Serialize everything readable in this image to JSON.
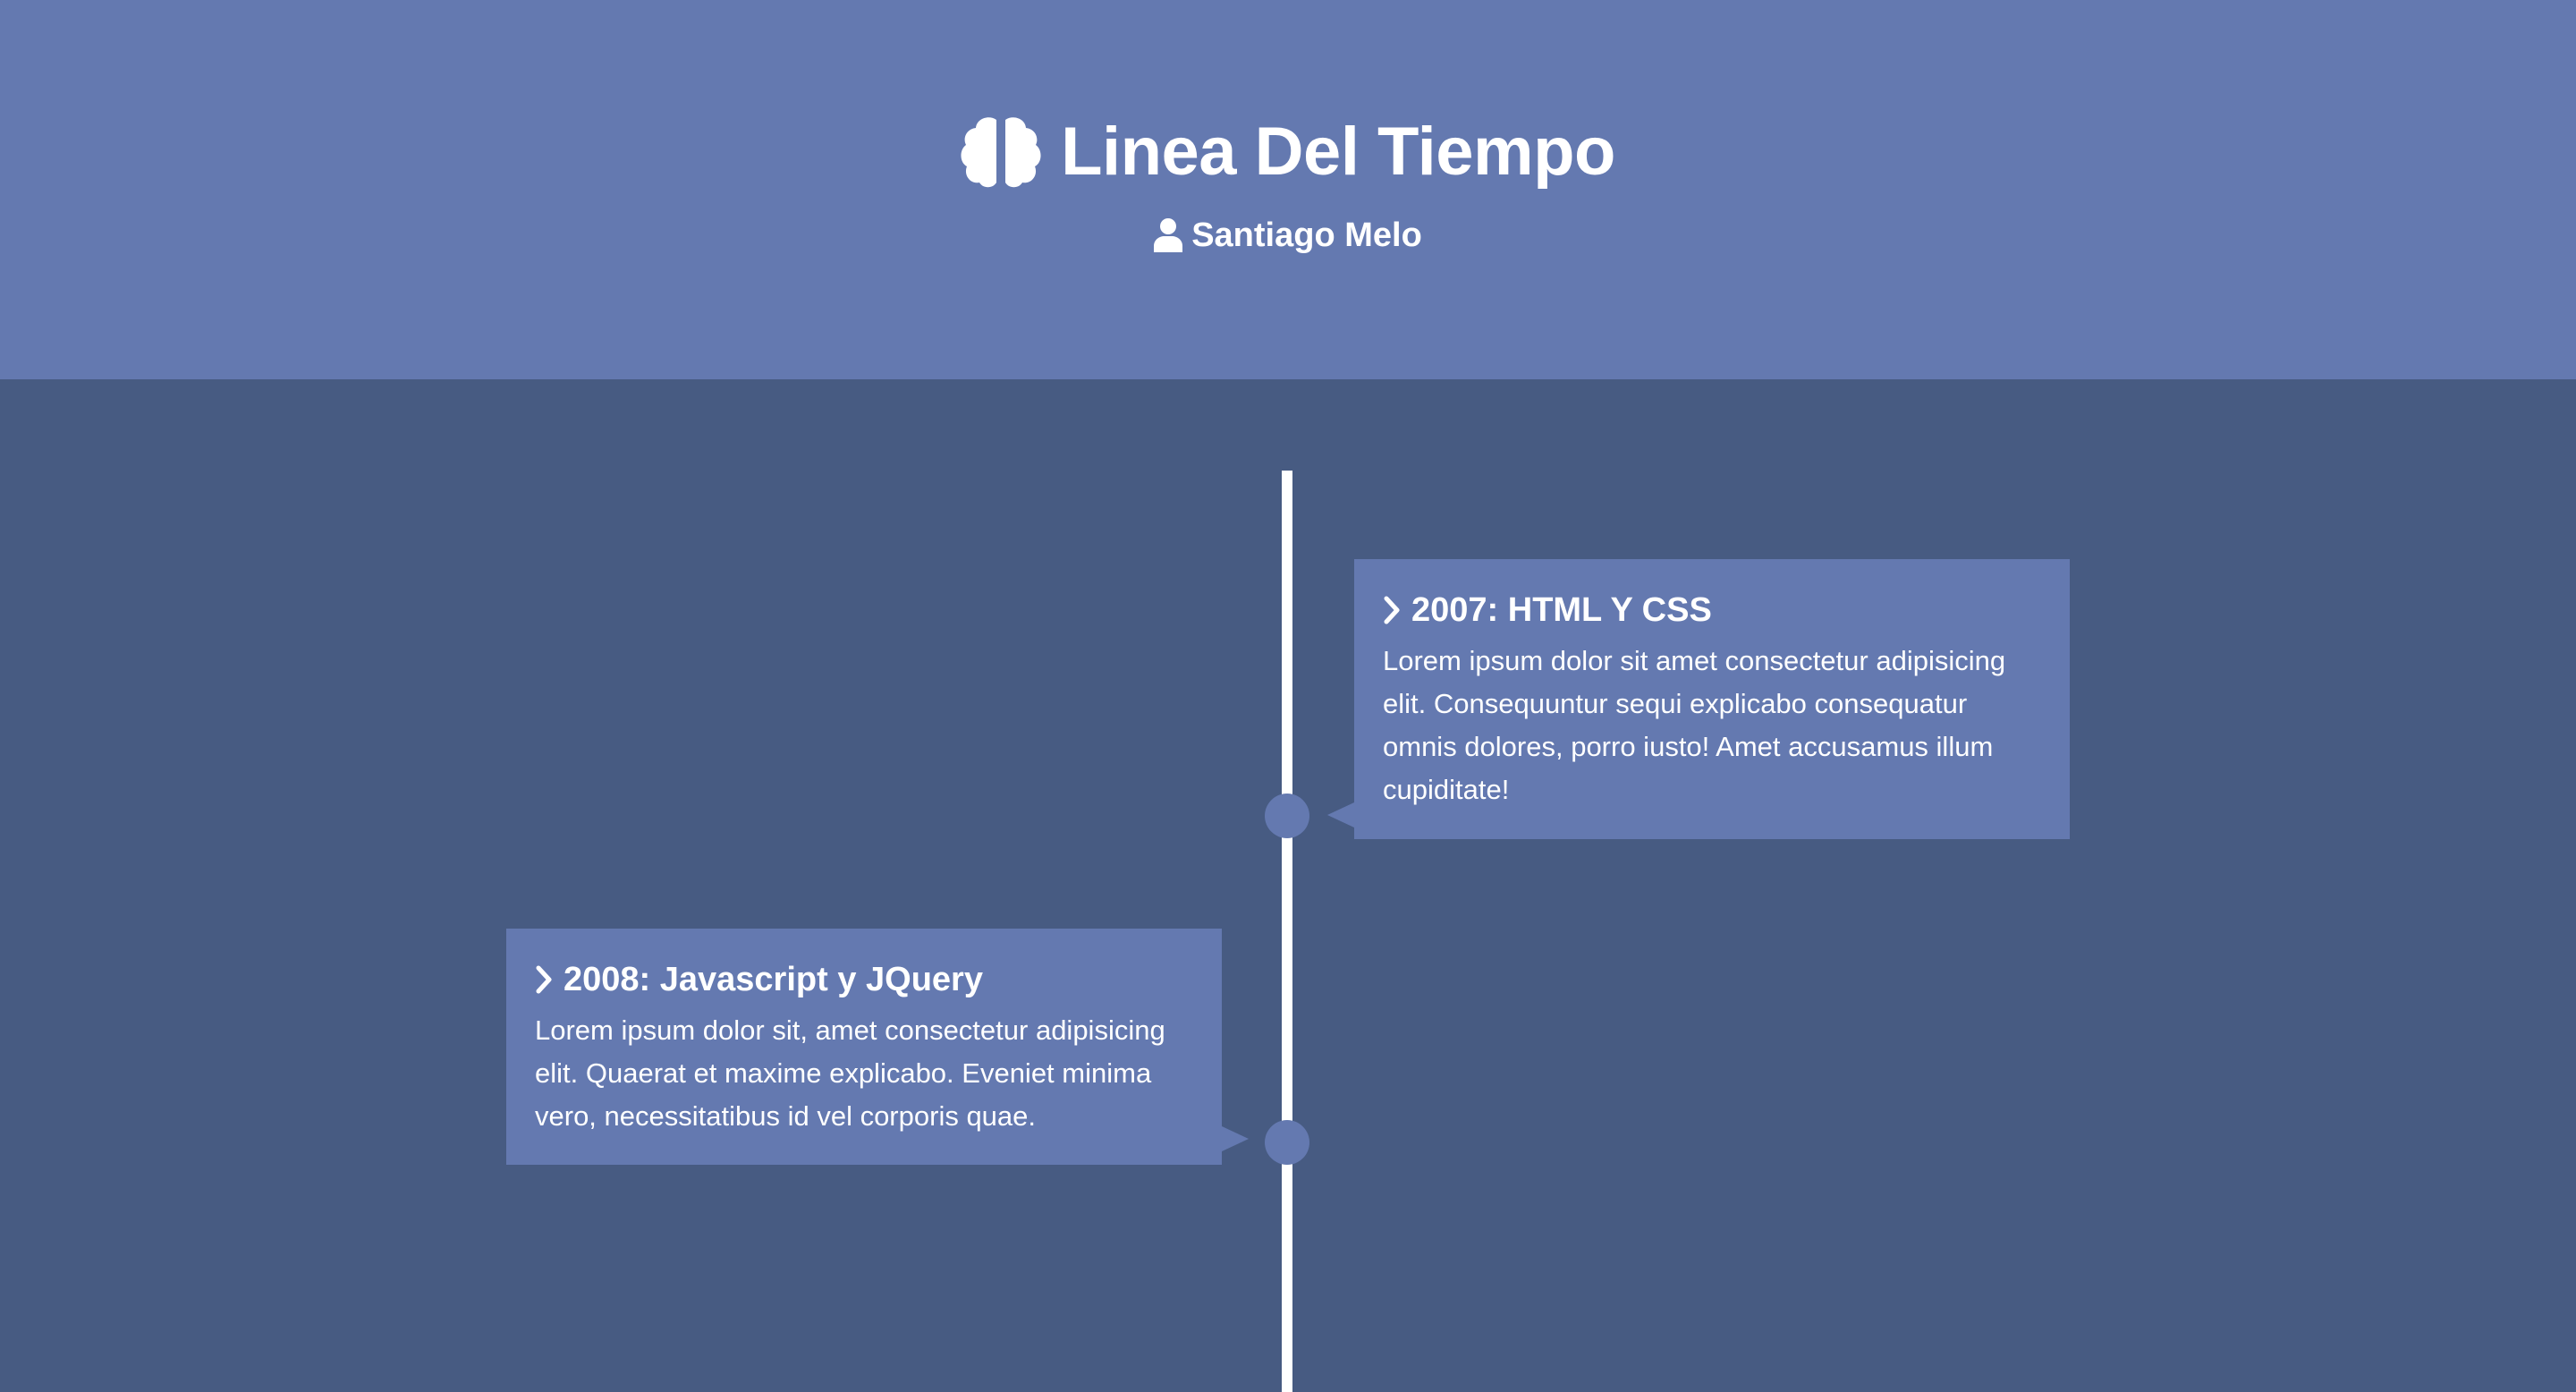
{
  "header": {
    "title": "Linea Del Tiempo",
    "author": "Santiago Melo",
    "icons": {
      "title": "brain-icon",
      "author": "user-icon"
    },
    "background": "#6479b0"
  },
  "timeline": {
    "background": "#475b82",
    "line_color": "#ffffff",
    "items": [
      {
        "title": "2007: HTML Y CSS",
        "body": "Lorem ipsum dolor sit amet consectetur adipisicing elit. Consequuntur sequi explicabo consequatur omnis dolores, porro iusto! Amet accusamus illum cupiditate!",
        "side": "right",
        "icon": "chevron-right-icon"
      },
      {
        "title": "2008: Javascript y JQuery",
        "body": "Lorem ipsum dolor sit, amet consectetur adipisicing elit. Quaerat et maxime explicabo. Eveniet minima vero, necessitatibus id vel corporis quae.",
        "side": "left",
        "icon": "chevron-right-icon"
      }
    ]
  }
}
